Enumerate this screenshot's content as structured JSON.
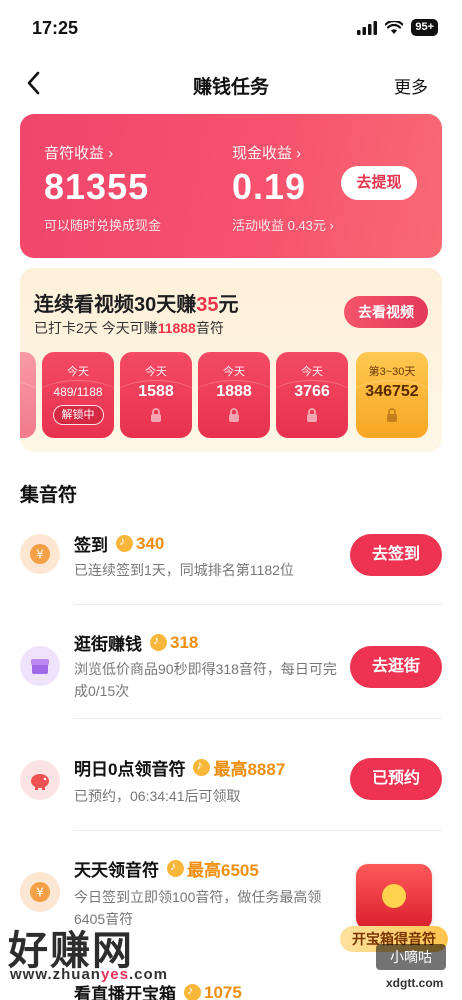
{
  "status": {
    "time": "17:25",
    "battery": "95+"
  },
  "nav": {
    "title": "赚钱任务",
    "more": "更多"
  },
  "earnings": {
    "coins_label": "音符收益 ›",
    "coins_value": "81355",
    "coins_sub": "可以随时兑换成现金",
    "cash_label": "现金收益 ›",
    "cash_value": "0.19",
    "cash_sub": "活动收益 0.43元 ›",
    "withdraw_label": "去提现"
  },
  "streak": {
    "title_pre": "连续看视频30天赚",
    "title_amount": "35",
    "title_post": "元",
    "sub_pre": "已打卡2天  今天可赚",
    "sub_amount": "11888",
    "sub_post": "音符",
    "watch_label": "去看视频",
    "days": [
      {
        "label": "今天",
        "value": "489/1188",
        "chip": "解锁中"
      },
      {
        "label": "今天",
        "value": "1588"
      },
      {
        "label": "今天",
        "value": "1888"
      },
      {
        "label": "今天",
        "value": "3766"
      },
      {
        "label": "第3~30天",
        "value": "346752"
      }
    ]
  },
  "section_title": "集音符",
  "tasks": [
    {
      "title": "签到",
      "reward": "340",
      "desc": "已连续签到1天，同城排名第1182位",
      "button": "去签到"
    },
    {
      "title": "逛街赚钱",
      "reward": "318",
      "desc": "浏览低价商品90秒即得318音符，每日可完成0/15次",
      "button": "去逛街"
    },
    {
      "title": "明日0点领音符",
      "reward": "最高8887",
      "desc": "已预约，06:34:41后可领取",
      "button": "已预约"
    },
    {
      "title": "天天领音符",
      "reward": "最高6505",
      "desc": "今日签到立即领100音符，做任务最高领6405音符"
    },
    {
      "title": "看直播开宝箱",
      "reward": "1075"
    }
  ],
  "treasure_label": "开宝箱得音符",
  "watermark": {
    "big": "好赚网",
    "url_a": "www.zhuan",
    "url_b": "yes",
    "url_c": ".com",
    "badge": "小嘀咕",
    "site": "xdgtt.com"
  },
  "colors": {
    "accent": "#ee3352",
    "reward": "#ee8f11",
    "card": "#f1456b"
  }
}
